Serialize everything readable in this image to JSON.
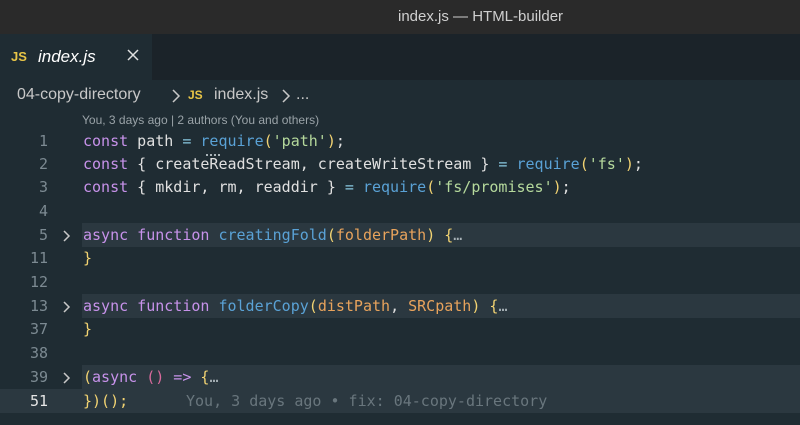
{
  "window": {
    "title": "index.js — HTML-builder"
  },
  "tab": {
    "badge": "JS",
    "label": "index.js"
  },
  "breadcrumb": {
    "folder": "04-copy-directory",
    "badge": "JS",
    "file": "index.js",
    "more": "..."
  },
  "blame_header": "You, 3 days ago | 2 authors (You and others)",
  "lines": [
    {
      "n": "1"
    },
    {
      "n": "2"
    },
    {
      "n": "3"
    },
    {
      "n": "4"
    },
    {
      "n": "5"
    },
    {
      "n": "11"
    },
    {
      "n": "12"
    },
    {
      "n": "13"
    },
    {
      "n": "37"
    },
    {
      "n": "38"
    },
    {
      "n": "39"
    },
    {
      "n": "51"
    }
  ],
  "code": {
    "l1": {
      "kw": "const",
      "name": " path ",
      "eq": "=",
      "fn": " require",
      "p1": "(",
      "str": "'path'",
      "p2": ")",
      "end": ";"
    },
    "l2": {
      "kw": "const",
      "body": " { createReadStream, createWriteStream } ",
      "eq": "=",
      "fn": " require",
      "p1": "(",
      "str": "'fs'",
      "p2": ")",
      "end": ";"
    },
    "l3": {
      "kw": "const",
      "body": " { mkdir, rm, readdir } ",
      "eq": "=",
      "fn": " require",
      "p1": "(",
      "str": "'fs/promises'",
      "p2": ")",
      "end": ";"
    },
    "l5": {
      "kw1": "async",
      "kw2": " function",
      "fn": " creatingFold",
      "p1": "(",
      "param": "folderPath",
      "p2": ")",
      "brace": " {",
      "dots": "…"
    },
    "l11": {
      "brace": "}"
    },
    "l13": {
      "kw1": "async",
      "kw2": " function",
      "fn": " folderCopy",
      "p1": "(",
      "param1": "distPath",
      "comma": ", ",
      "param2": "SRCpath",
      "p2": ")",
      "brace": " {",
      "dots": "…"
    },
    "l37": {
      "brace": "}"
    },
    "l39": {
      "p1": "(",
      "kw": "async",
      "pa": " ()",
      "arrow": " =>",
      "brace": " {",
      "dots": "…"
    },
    "l51": {
      "text": "})();",
      "blame": "You, 3 days ago • fix: 04-copy-directory"
    }
  },
  "colors": {
    "background": "#1f2c33",
    "keyword": "#c792ea",
    "function": "#5aa2d6",
    "string": "#b5d99c",
    "parameter": "#e8a35c",
    "badge": "#e8c547"
  }
}
